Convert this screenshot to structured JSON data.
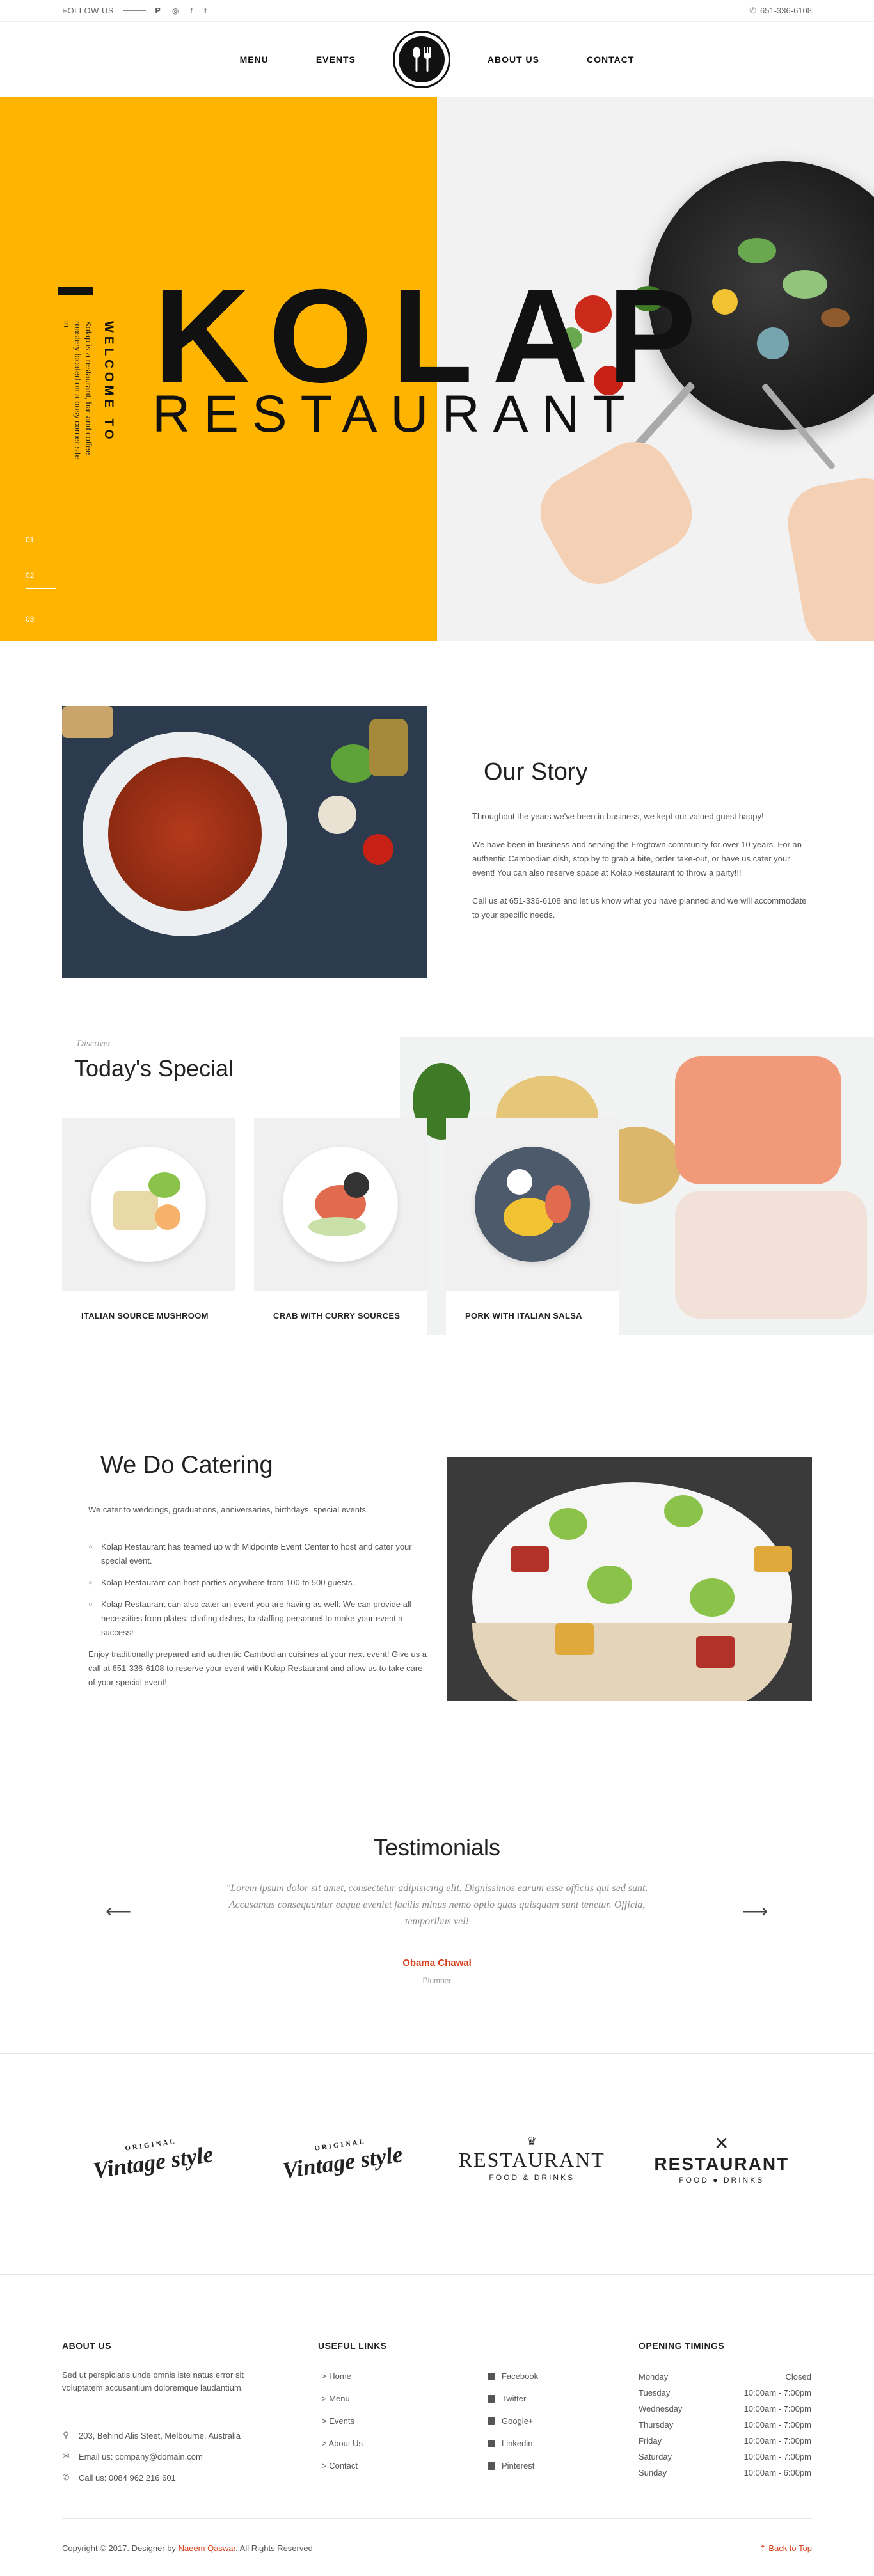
{
  "topbar": {
    "follow_label": "FOLLOW US",
    "social": [
      "𝗣",
      "◎",
      "f",
      "𝕥"
    ],
    "phone": "651-336-6108"
  },
  "nav": {
    "left": [
      "MENU",
      "EVENTS"
    ],
    "right": [
      "ABOUT US",
      "CONTACT"
    ]
  },
  "hero": {
    "welcome": "WELCOME TO",
    "description": "Kolap is a restaurant, bar and coffee roastery located on a busy corner site in",
    "title": "KOLAP",
    "subtitle": "RESTAURANT",
    "slides": [
      "01",
      "02",
      "03"
    ],
    "colors": {
      "accent": "#ffb400"
    }
  },
  "story": {
    "title": "Our Story",
    "paragraphs": [
      "Throughout the years we've been in business, we kept our valued guest happy!",
      "We have been in business and serving the Frogtown community for over 10 years. For an authentic Cambodian dish, stop by to grab a bite, order take-out, or have us cater your event! You can also reserve space at Kolap Restaurant to throw a party!!!",
      "Call us at 651-336-6108 and let us know what you have planned and we will accommodate to your specific needs."
    ]
  },
  "special": {
    "discover": "Discover",
    "title": "Today's Special",
    "items": [
      {
        "label": "ITALIAN SOURCE MUSHROOM"
      },
      {
        "label": "CRAB WITH CURRY SOURCES"
      },
      {
        "label": "PORK WITH ITALIAN SALSA"
      }
    ]
  },
  "catering": {
    "title": "We Do Catering",
    "intro": "We cater to weddings, graduations, anniversaries, birthdays, special events.",
    "bullets": [
      "Kolap Restaurant has teamed up with Midpointe Event Center to host and cater your special event.",
      "Kolap Restaurant can host parties anywhere from 100 to 500 guests.",
      "Kolap Restaurant can also cater an event you are having as well. We can provide all necessities from plates, chafing dishes, to staffing personnel to make your event a success!"
    ],
    "outro": "Enjoy traditionally prepared and authentic Cambodian cuisines at your next event! Give us a call at 651-336-6108 to reserve your event with Kolap Restaurant and allow us to take care of your special event!"
  },
  "testimonials": {
    "title": "Testimonials",
    "quote": "\"Lorem ipsum dolor sit amet, consectetur adipisicing elit. Dignissimos earum esse officiis qui sed sunt. Accusamus consequuntur eaque eveniet facilis minus nemo optio quas quisquam sunt tenetur. Officia, temporibus vel!",
    "author": "Obama Chawal",
    "role": "Plumber",
    "prev": "⟵",
    "next": "⟶"
  },
  "brands": [
    {
      "type": "vintage",
      "top": "ORIGINAL",
      "name": "Vintage style"
    },
    {
      "type": "vintage",
      "top": "ORIGINAL",
      "name": "Vintage style"
    },
    {
      "type": "restaurant",
      "name": "RESTAURANT",
      "sub": "FOOD & DRINKS"
    },
    {
      "type": "restaurant2",
      "name": "RESTAURANT",
      "sub": "FOOD ● DRINKS"
    }
  ],
  "footer": {
    "about_title": "ABOUT US",
    "about_text": "Sed ut perspiciatis unde omnis iste natus error sit voluptatem accusantium doloremque laudantium.",
    "address": "203, Behind Alis Steet, Melbourne, Australia",
    "email": "Email us: company@domain.com",
    "phone": "Call us: 0084 962 216 601",
    "links_title": "USEFUL LINKS",
    "links": [
      "> Home",
      "> Menu",
      "> Events",
      "> About Us",
      "> Contact"
    ],
    "social": [
      "Facebook",
      "Twitter",
      "Google+",
      "Linkedin",
      "Pinterest"
    ],
    "hours_title": "OPENING TIMINGS",
    "hours": [
      {
        "day": "Monday",
        "time": "Closed"
      },
      {
        "day": "Tuesday",
        "time": "10:00am - 7:00pm"
      },
      {
        "day": "Wednesday",
        "time": "10:00am - 7:00pm"
      },
      {
        "day": "Thursday",
        "time": "10:00am - 7:00pm"
      },
      {
        "day": "Friday",
        "time": "10:00am - 7:00pm"
      },
      {
        "day": "Saturday",
        "time": "10:00am - 7:00pm"
      },
      {
        "day": "Sunday",
        "time": "10:00am - 6:00pm"
      }
    ],
    "copyright_pre": "Copyright © 2017. Designer by ",
    "copyright_name": "Naeem Qaswar",
    "copyright_post": ". All Rights Reserved",
    "back_top": "Back to Top"
  },
  "colors": {
    "accent": "#d9431e",
    "yellow": "#ffb400"
  }
}
